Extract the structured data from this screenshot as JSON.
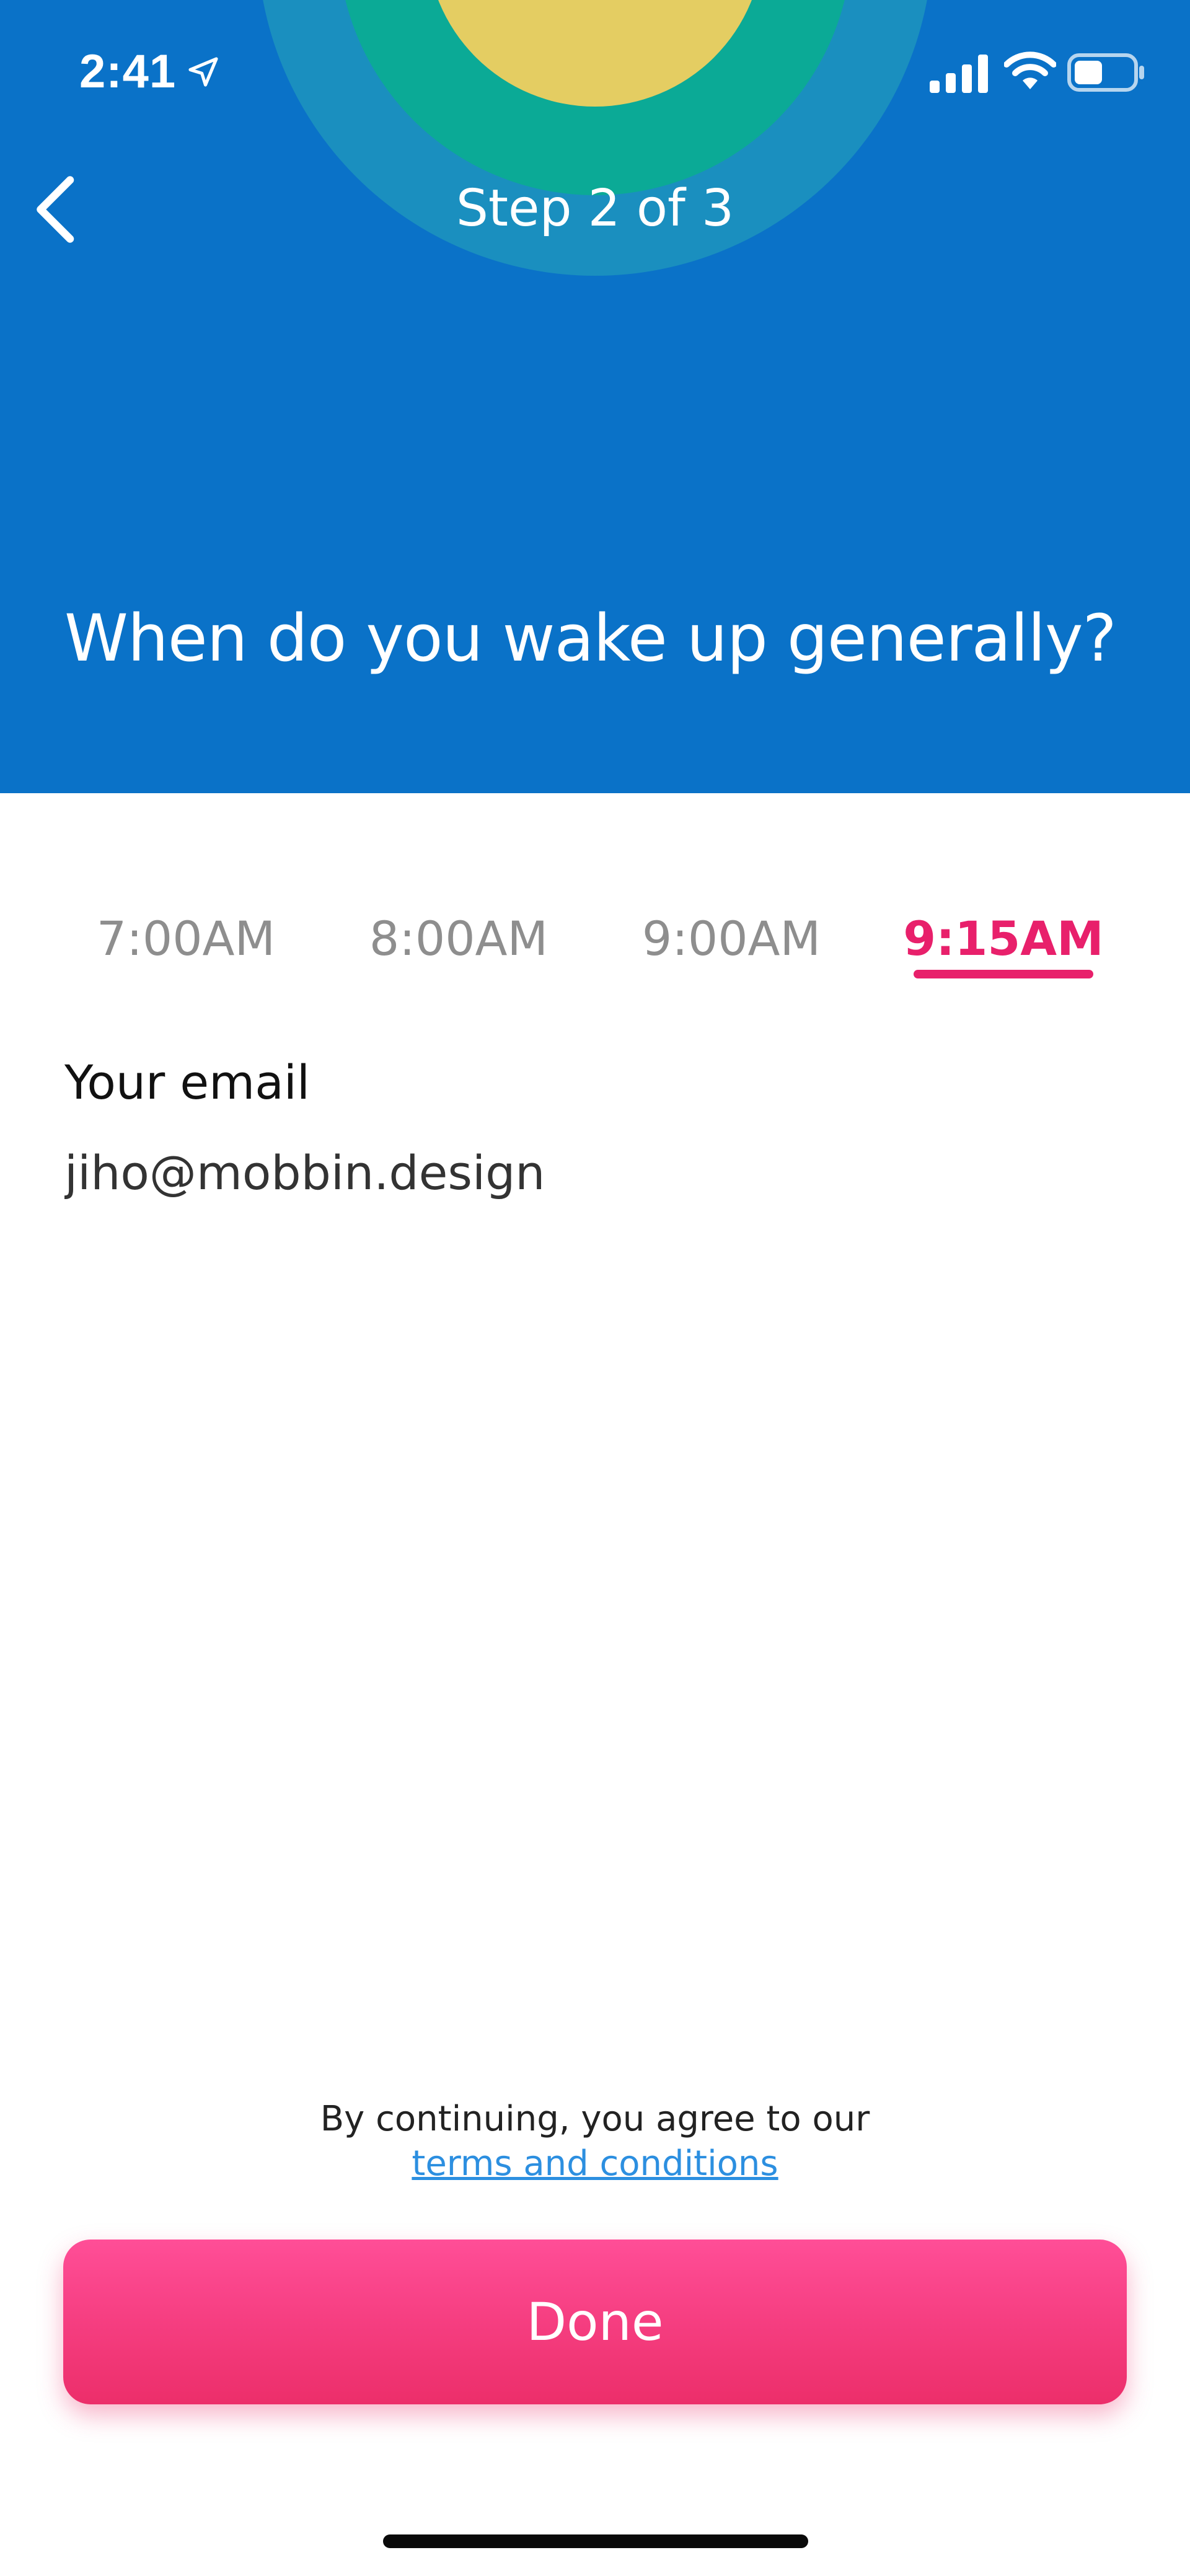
{
  "status_bar": {
    "time": "2:41",
    "icons": [
      "location-arrow-icon",
      "signal-icon",
      "wifi-icon",
      "battery-icon"
    ]
  },
  "nav": {
    "back_icon": "chevron-left-icon",
    "step_label": "Step 2 of 3"
  },
  "question": "When do you wake up generally?",
  "time_picker": {
    "options": [
      {
        "label": "7:00AM",
        "selected": false
      },
      {
        "label": "8:00AM",
        "selected": false
      },
      {
        "label": "9:00AM",
        "selected": false
      },
      {
        "label": "9:15AM",
        "selected": true
      }
    ]
  },
  "email": {
    "label": "Your email",
    "value": "jiho@mobbin.design"
  },
  "terms": {
    "text": "By continuing, you agree to our",
    "link_label": "terms and conditions"
  },
  "done_label": "Done",
  "colors": {
    "header_blue": "#0A72C8",
    "accent_pink": "#E8206B",
    "button_pink": "#F43F7E",
    "link_blue": "#2C8FE0"
  }
}
